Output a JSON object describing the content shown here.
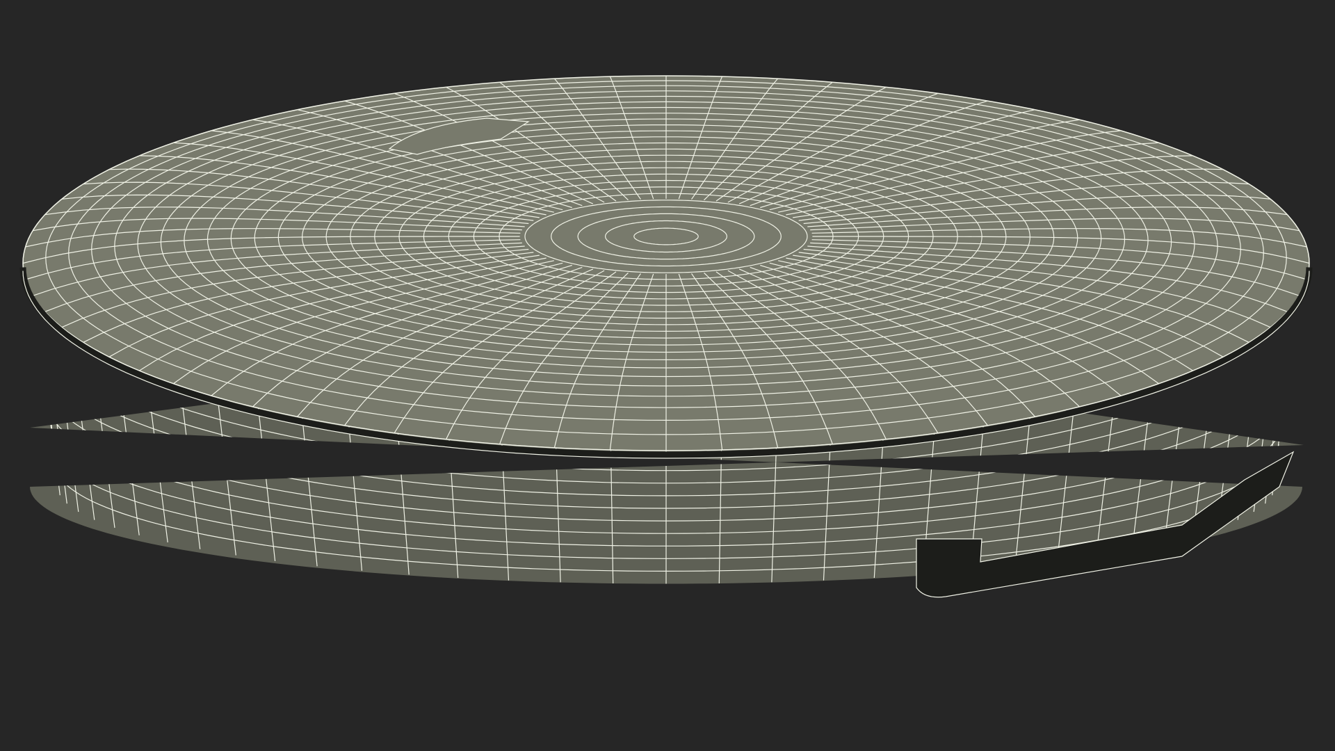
{
  "scene": {
    "subject": "wireframe-render",
    "colors": {
      "background": "#262626",
      "surface": "#787a6c",
      "surface_shade": "#5e6055",
      "groove": "#1c1d1a",
      "wire": "#f0f2e6"
    }
  }
}
